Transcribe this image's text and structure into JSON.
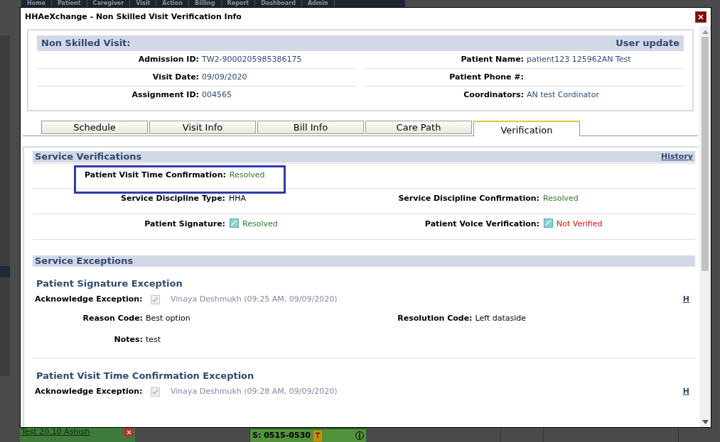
{
  "background_app": {
    "menu": [
      "Home",
      "Patient",
      "Caregiver",
      "Visit",
      "Action",
      "Billing",
      "Report",
      "Dashboard",
      "Admin"
    ],
    "bottom_cells": [
      {
        "kind": "task",
        "text": "Test 20.10 Ashish"
      },
      {
        "kind": "shift",
        "text": "S: 0515-0530",
        "badge": "T"
      }
    ]
  },
  "dialog": {
    "title": "HHAeXchange - Non Skilled Visit Verification Info"
  },
  "visit": {
    "heading": "Non Skilled Visit:",
    "action": "User update",
    "rows": [
      [
        {
          "label": "Admission ID:",
          "value": "TW2-9000205985386175"
        },
        {
          "label": "Patient Name:",
          "value": "patient123 125962AN Test"
        }
      ],
      [
        {
          "label": "Visit Date:",
          "value": "09/09/2020"
        },
        {
          "label": "Patient Phone #:"
        }
      ],
      [
        {
          "label": "Assignment ID:",
          "value": "004565"
        },
        {
          "label": "Coordinators:",
          "value": "AN test Cordinator"
        }
      ]
    ]
  },
  "tabs": [
    {
      "label": "Schedule",
      "selected": false
    },
    {
      "label": "Visit Info",
      "selected": false
    },
    {
      "label": "Bill Info",
      "selected": false
    },
    {
      "label": "Care Path",
      "selected": false
    },
    {
      "label": "Verification",
      "selected": true
    }
  ],
  "verifications": {
    "title": "Service Verifications",
    "link": "History",
    "rows": [
      [
        {
          "label": "Patient Visit Time Confirmation:",
          "value": "Resolved",
          "color": "#2c7a2c",
          "icon": false,
          "highlighted": true
        }
      ],
      [
        {
          "label": "Service Discipline Type:",
          "value": "HHA",
          "color": "#000000",
          "icon": false,
          "highlighted": false
        },
        {
          "label": "Service Discipline Confirmation:",
          "value": "Resolved",
          "color": "#2c7a2c",
          "icon": false,
          "highlighted": false
        }
      ],
      [
        {
          "label": "Patient Signature:",
          "value": "Resolved",
          "color": "#2c7a2c",
          "icon": true,
          "highlighted": false
        },
        {
          "label": "Patient Voice Verification:",
          "value": "Not Verified",
          "color": "#e01010",
          "icon": true,
          "highlighted": false
        }
      ]
    ]
  },
  "exceptions": {
    "title": "Service Exceptions",
    "items": [
      {
        "title": "Patient Signature Exception",
        "ack_label": "Acknowledge Exception:",
        "checked": true,
        "ack_by": "Vinaya Deshmukh (09:25 AM, 09/09/2020)",
        "link": "H",
        "details": [
          [
            {
              "label": "Reason Code:",
              "value": "Best option"
            },
            {
              "label": "Resolution Code:",
              "value": "Left dataside"
            }
          ],
          [
            {
              "label": "Notes:",
              "value": "test"
            }
          ]
        ]
      },
      {
        "title": "Patient Visit Time Confirmation Exception",
        "ack_label": "Acknowledge Exception:",
        "checked": true,
        "ack_by": "Vinaya Deshmukh (09:28 AM, 09/09/2020)",
        "link": "H"
      }
    ]
  }
}
